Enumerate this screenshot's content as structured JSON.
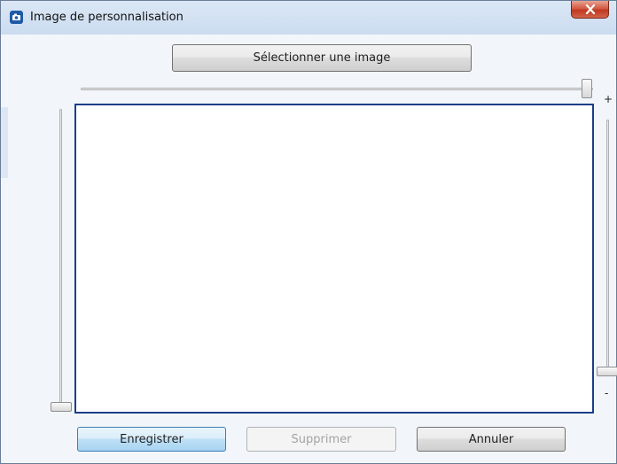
{
  "window": {
    "title": "Image de personnalisation",
    "icon": "camera-icon",
    "close_icon": "close-icon"
  },
  "toolbar": {
    "select_label": "Sélectionner une image"
  },
  "zoom": {
    "horizontal_level": 1.0,
    "vertical_left_level": 0.0,
    "vertical_right_level": 0.0,
    "plus_label": "+",
    "minus_label": "-"
  },
  "actions": {
    "save_label": "Enregistrer",
    "delete_label": "Supprimer",
    "cancel_label": "Annuler"
  },
  "colors": {
    "canvas_border": "#1b3e87",
    "close_button": "#c0391f",
    "primary_button_border": "#3c7fb1"
  }
}
